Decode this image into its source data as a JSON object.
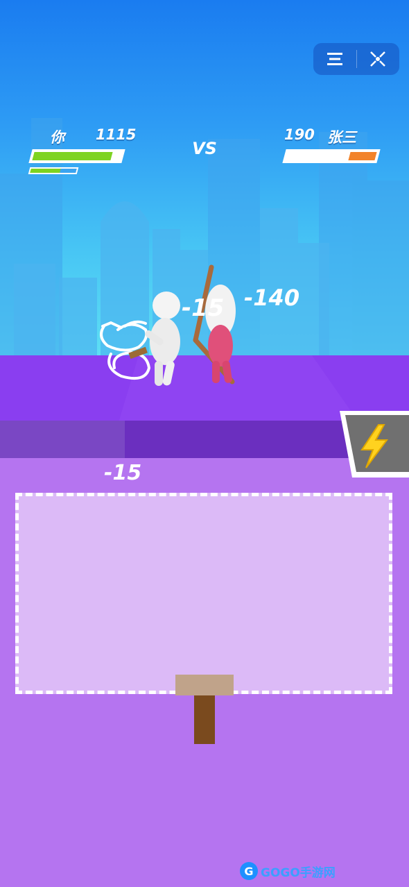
{
  "hud": {
    "player_name": "你",
    "player_score": "1115",
    "vs_label": "VS",
    "enemy_score": "190",
    "enemy_name": "张三",
    "player_health": 0.9,
    "player_energy": 0.65,
    "enemy_health": 0.3,
    "colors": {
      "player_health": "#7ed321",
      "player_energy": "#3aa4f0",
      "enemy_health": "#f2832a"
    }
  },
  "menu": {
    "menu_icon": "list-icon",
    "close_icon": "close-icon"
  },
  "floating_damage": {
    "near_player": "-15",
    "near_enemy": "-140",
    "above_pad": "-15"
  },
  "power": {
    "icon": "lightning-bolt-icon"
  },
  "watermark": {
    "text": "GOGO手游网"
  }
}
